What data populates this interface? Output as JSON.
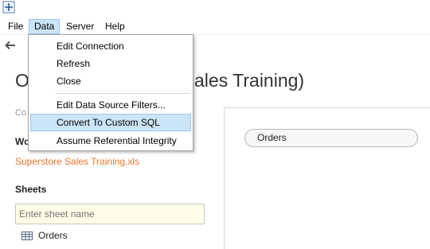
{
  "menubar": {
    "items": [
      {
        "label": "File"
      },
      {
        "label": "Data"
      },
      {
        "label": "Server"
      },
      {
        "label": "Help"
      }
    ]
  },
  "data_menu": {
    "items": [
      {
        "label": "Edit Connection"
      },
      {
        "label": "Refresh"
      },
      {
        "label": "Close"
      },
      {
        "label": "Edit Data Source Filters..."
      },
      {
        "label": "Convert To Custom SQL",
        "highlighted": true
      },
      {
        "label": "Assume Referential Integrity"
      }
    ]
  },
  "datasource": {
    "title_prefix": "O",
    "title_suffix": "ales Training)",
    "connections_label": "Co",
    "workbook_label": "Wo",
    "file_name": "Superstore Sales Training.xls",
    "sheets_label": "Sheets",
    "sheet_search_placeholder": "Enter sheet name",
    "sheets": [
      {
        "name": "Orders"
      }
    ]
  },
  "canvas": {
    "table_name": "Orders"
  },
  "colors": {
    "accent": "#e8762d",
    "highlight": "#cce4f7",
    "input_bg": "#fdfde8"
  }
}
